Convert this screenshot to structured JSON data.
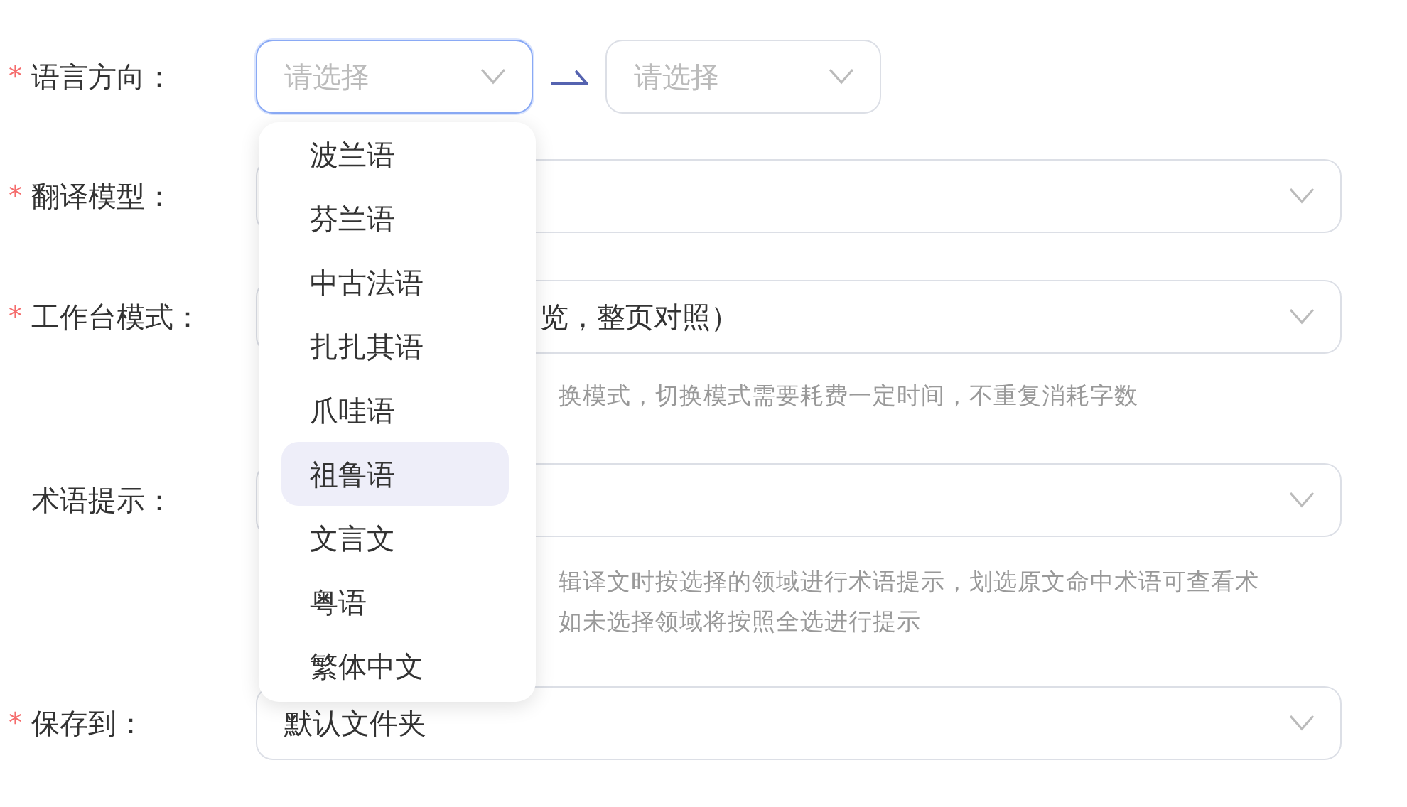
{
  "fields": [
    {
      "kind": "pair",
      "label": "语言方向：",
      "marker": "*",
      "source": {
        "placeholder": "请选择",
        "focused": true
      },
      "target": {
        "placeholder": "请选择",
        "focused": false
      }
    },
    {
      "kind": "select",
      "label": "翻译模型：",
      "marker": "*"
    },
    {
      "kind": "select",
      "label": "工作台模式：",
      "marker": "*",
      "value": "览，整页对照）",
      "help": [
        "换模式，切换模式需要耗费一定时间，不重复消耗字数"
      ]
    },
    {
      "kind": "select",
      "label": "术语提示：",
      "help": [
        "辑译文时按选择的领域进行术语提示，划选原文命中术语可查看术",
        "如未选择领域将按照全选进行提示"
      ]
    },
    {
      "kind": "select",
      "label": "保存到：",
      "marker": "*",
      "value": "默认文件夹"
    }
  ],
  "dropdown": {
    "options": [
      {
        "label": "波兰语",
        "selected": false
      },
      {
        "label": "芬兰语",
        "selected": false
      },
      {
        "label": "中古法语",
        "selected": false
      },
      {
        "label": "扎扎其语",
        "selected": false
      },
      {
        "label": "爪哇语",
        "selected": false
      },
      {
        "label": "祖鲁语",
        "selected": true
      },
      {
        "label": "文言文",
        "selected": false
      },
      {
        "label": "粤语",
        "selected": false
      },
      {
        "label": "繁体中文",
        "selected": false
      }
    ]
  }
}
